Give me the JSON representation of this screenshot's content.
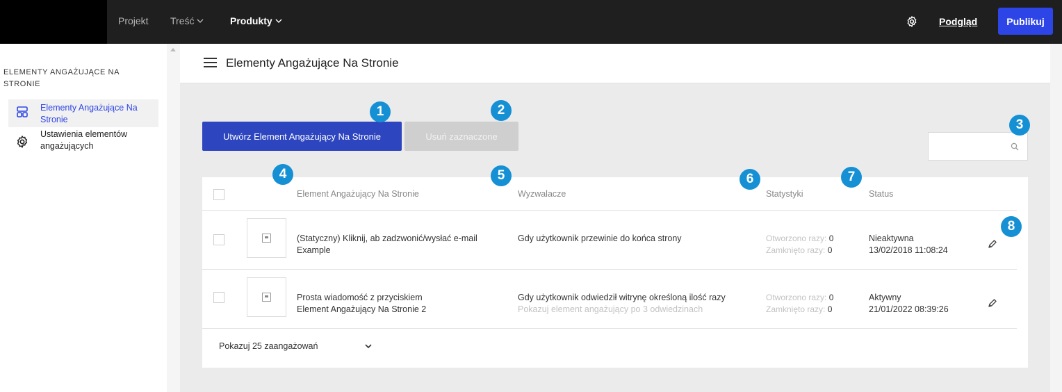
{
  "topbar": {
    "nav": [
      "Projekt",
      "Treść",
      "Produkty"
    ],
    "preview_label": "Podgląd",
    "publish_label": "Publikuj"
  },
  "sidebar": {
    "title": "ELEMENTY ANGAŻUJĄCE NA STRONIE",
    "items": [
      {
        "label": "Elementy Angażujące Na Stronie",
        "icon": "layout-icon",
        "active": true
      },
      {
        "label": "Ustawienia elementów angażujących",
        "icon": "gear-icon",
        "active": false
      }
    ]
  },
  "page": {
    "title": "Elementy Angażujące Na Stronie",
    "create_label": "Utwórz Element Angażujący Na Stronie",
    "delete_label": "Usuń zaznaczone"
  },
  "table": {
    "headers": [
      "Element Angażujący Na Stronie",
      "Wyzwalacze",
      "Statystyki",
      "Status"
    ],
    "rows": [
      {
        "name1": "(Statyczny) Kliknij, ab zadzwonić/wysłać e-mail",
        "name2": "Example",
        "trigger": "Gdy użytkownik przewinie do końca strony",
        "trigger_sub": "",
        "opened_label": "Otworzono razy:",
        "opened": "0",
        "closed_label": "Zamknięto razy:",
        "closed": "0",
        "status": "Nieaktywna",
        "date": "13/02/2018 11:08:24"
      },
      {
        "name1": "Prosta wiadomość z przyciskiem",
        "name2": "Element Angażujący Na Stronie 2",
        "trigger": "Gdy użytkownik odwiedził witrynę określoną ilość razy",
        "trigger_sub": "Pokazuj element angażujący po 3 odwiedzinach",
        "opened_label": "Otworzono razy:",
        "opened": "0",
        "closed_label": "Zamknięto razy:",
        "closed": "0",
        "status": "Aktywny",
        "date": "21/01/2022 08:39:26"
      }
    ],
    "pager_label": "Pokazuj 25 zaangażowań"
  },
  "badges": [
    "1",
    "2",
    "3",
    "4",
    "5",
    "6",
    "7",
    "8"
  ],
  "colors": {
    "accent": "#2d45e6",
    "badge": "#1690d4",
    "topbar": "#1f1f1f"
  }
}
